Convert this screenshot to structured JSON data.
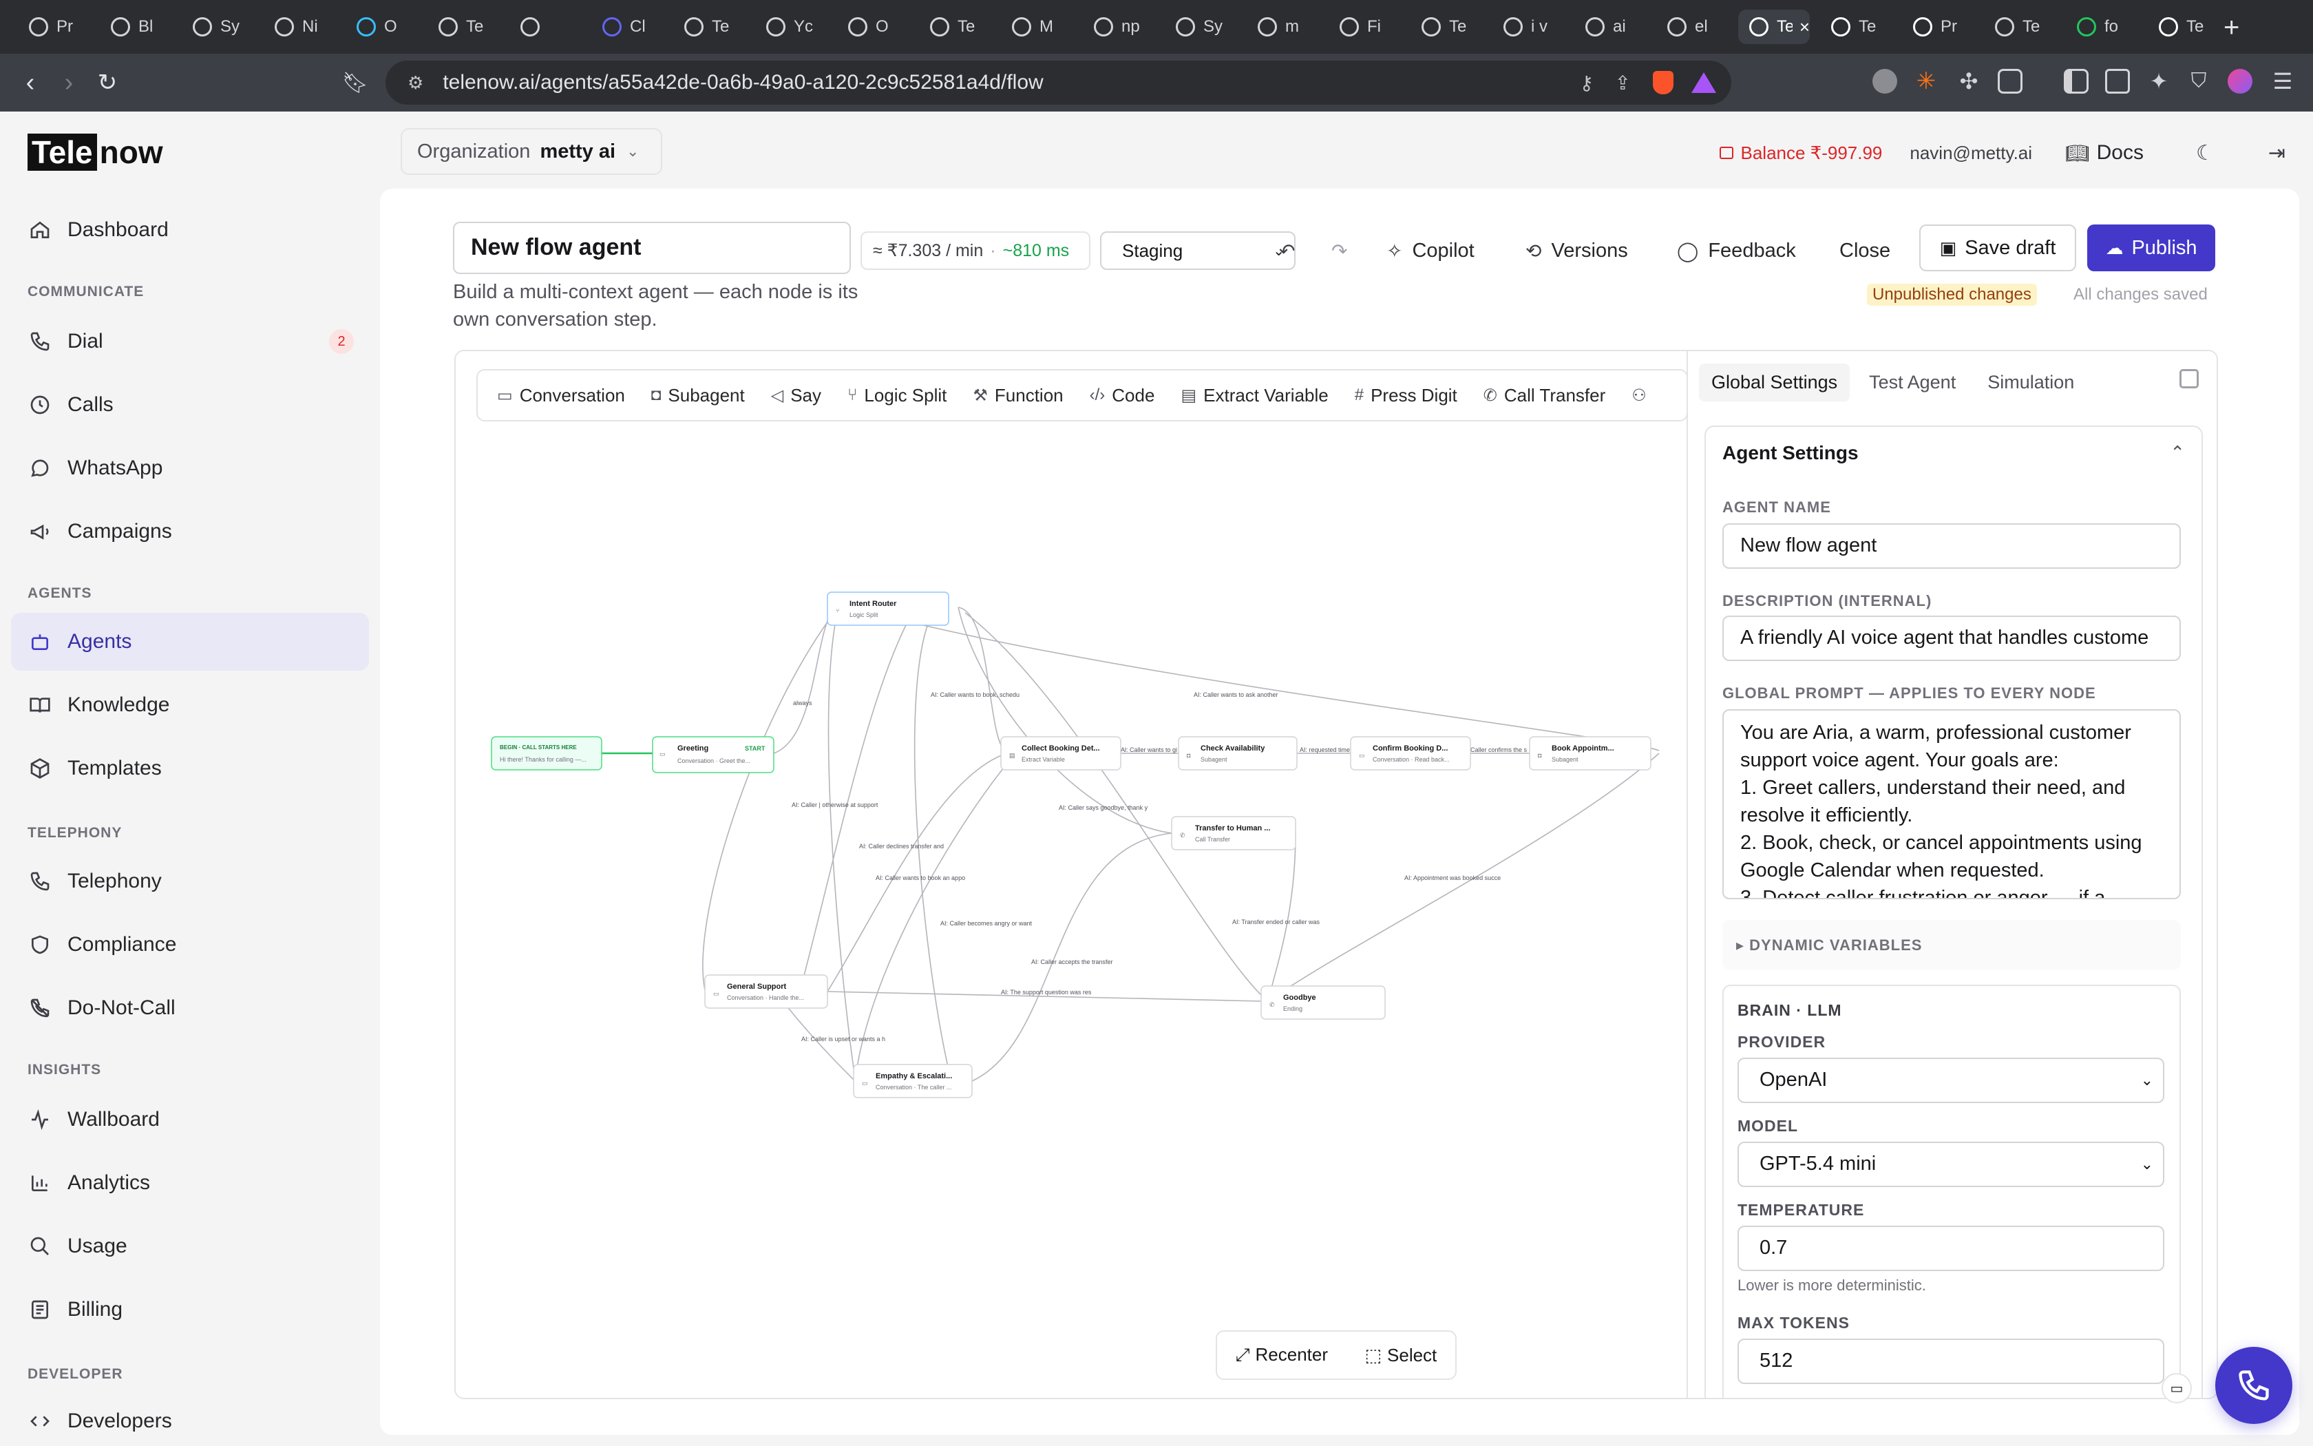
{
  "browser": {
    "tabs": [
      "Pr",
      "Bl",
      "Sy",
      "Ni",
      "O",
      "Te",
      "",
      "Cl",
      "Te",
      "Yc",
      "O",
      "Te",
      "M",
      "np",
      "Sy",
      "m",
      "Fi",
      "Te",
      "i v",
      "ai",
      "el",
      "Te",
      "Te",
      "Pr",
      "Te",
      "fo",
      "Te"
    ],
    "active_tab_index": 21,
    "url": "telenow.ai/agents/a55a42de-0a6b-49a0-a120-2c9c52581a4d/flow"
  },
  "brand": {
    "part1": "Tele",
    "part2": "now"
  },
  "sidebar": {
    "sections": {
      "communicate": "COMMUNICATE",
      "agents": "AGENTS",
      "telephony": "TELEPHONY",
      "insights": "INSIGHTS",
      "developer": "DEVELOPER"
    },
    "items": {
      "dashboard": "Dashboard",
      "dial": "Dial",
      "dial_badge": "2",
      "calls": "Calls",
      "whatsapp": "WhatsApp",
      "campaigns": "Campaigns",
      "agents": "Agents",
      "knowledge": "Knowledge",
      "templates": "Templates",
      "telephony": "Telephony",
      "compliance": "Compliance",
      "dnc": "Do-Not-Call",
      "wallboard": "Wallboard",
      "analytics": "Analytics",
      "usage": "Usage",
      "billing": "Billing",
      "developers": "Developers"
    }
  },
  "header": {
    "org_label": "Organization",
    "org_value": "metty ai",
    "balance": "Balance ₹-997.99",
    "user": "navin@metty.ai",
    "docs": "Docs"
  },
  "editor": {
    "title": "New flow agent",
    "description": "Build a multi-context agent — each node is its own conversation step.",
    "cost": "≈ ₹7.303 / min",
    "latency": "~810 ms",
    "environment": "Staging",
    "copilot": "Copilot",
    "versions": "Versions",
    "feedback": "Feedback",
    "close": "Close",
    "save_draft": "Save draft",
    "publish": "Publish",
    "unpublished": "Unpublished changes",
    "saved_status": "All changes saved",
    "node_types": [
      "Conversation",
      "Subagent",
      "Say",
      "Logic Split",
      "Function",
      "Code",
      "Extract Variable",
      "Press Digit",
      "Call Transfer"
    ],
    "recenter": "Recenter",
    "select": "Select"
  },
  "flow": {
    "nodes": {
      "begin": {
        "title": "BEGIN · CALL STARTS HERE",
        "sub": "Hi there! Thanks for calling —..."
      },
      "greeting": {
        "title": "Greeting",
        "tag": "START",
        "sub": "Conversation · Greet the..."
      },
      "intent": {
        "title": "Intent Router",
        "sub": "Logic Split"
      },
      "collect": {
        "title": "Collect Booking Det...",
        "sub": "Extract Variable"
      },
      "check": {
        "title": "Check Availability",
        "sub": "Subagent"
      },
      "confirm": {
        "title": "Confirm Booking D...",
        "sub": "Conversation · Read back..."
      },
      "book": {
        "title": "Book Appointm...",
        "sub": "Subagent"
      },
      "transfer": {
        "title": "Transfer to Human ...",
        "sub": "Call Transfer"
      },
      "support": {
        "title": "General Support",
        "sub": "Conversation · Handle the..."
      },
      "empathy": {
        "title": "Empathy & Escalati...",
        "sub": "Conversation · The caller ..."
      },
      "goodbye": {
        "title": "Goodbye",
        "sub": "Ending"
      }
    },
    "edges": {
      "always": "always",
      "book": "AI: Caller wants to book, schedu",
      "another": "AI: Caller wants to ask another",
      "otherwise": "AI: Caller | otherwise at support",
      "declines": "AI: Caller declines transfer and",
      "book_appt": "AI: Caller wants to book an appo",
      "goodbye": "AI: Caller says goodbye, thank y",
      "angry": "AI: Caller becomes angry or want",
      "accepts": "AI: Caller accepts the transfer",
      "ended": "AI: Transfer ended or caller was",
      "booked": "AI: Appointment was booked succe",
      "resolved": "AI: The support question was res",
      "upset": "AI: Caller is upset or wants a h",
      "slots": "AI: requested time sl",
      "collected": "Al: Caller wants to gi",
      "confirms": "Caller confirms the s"
    }
  },
  "panel": {
    "tabs": [
      "Global Settings",
      "Test Agent",
      "Simulation"
    ],
    "section": "Agent Settings",
    "agent_name_label": "AGENT NAME",
    "agent_name": "New flow agent",
    "desc_label": "DESCRIPTION (INTERNAL)",
    "desc_value": "A friendly AI voice agent that handles custome",
    "prompt_label": "GLOBAL PROMPT — APPLIES TO EVERY NODE",
    "prompt": "You are Aria, a warm, professional customer support voice agent. Your goals are:\n1. Greet callers, understand their need, and resolve it efficiently.\n2. Book, check, or cancel appointments using Google Calendar when requested.\n3. Detect caller frustration or anger — if a",
    "dynamic_vars": "▸ DYNAMIC VARIABLES",
    "brain_label": "BRAIN · LLM",
    "provider_label": "PROVIDER",
    "provider": "OpenAI",
    "model_label": "MODEL",
    "model": "GPT-5.4 mini",
    "temp_label": "TEMPERATURE",
    "temp": "0.7",
    "temp_hint": "Lower is more deterministic.",
    "max_tokens_label": "MAX TOKENS",
    "max_tokens": "512"
  },
  "colors": {
    "accent": "#4338ca",
    "danger": "#dc2626",
    "success": "#16a34a",
    "warning_bg": "#fef3c7"
  }
}
